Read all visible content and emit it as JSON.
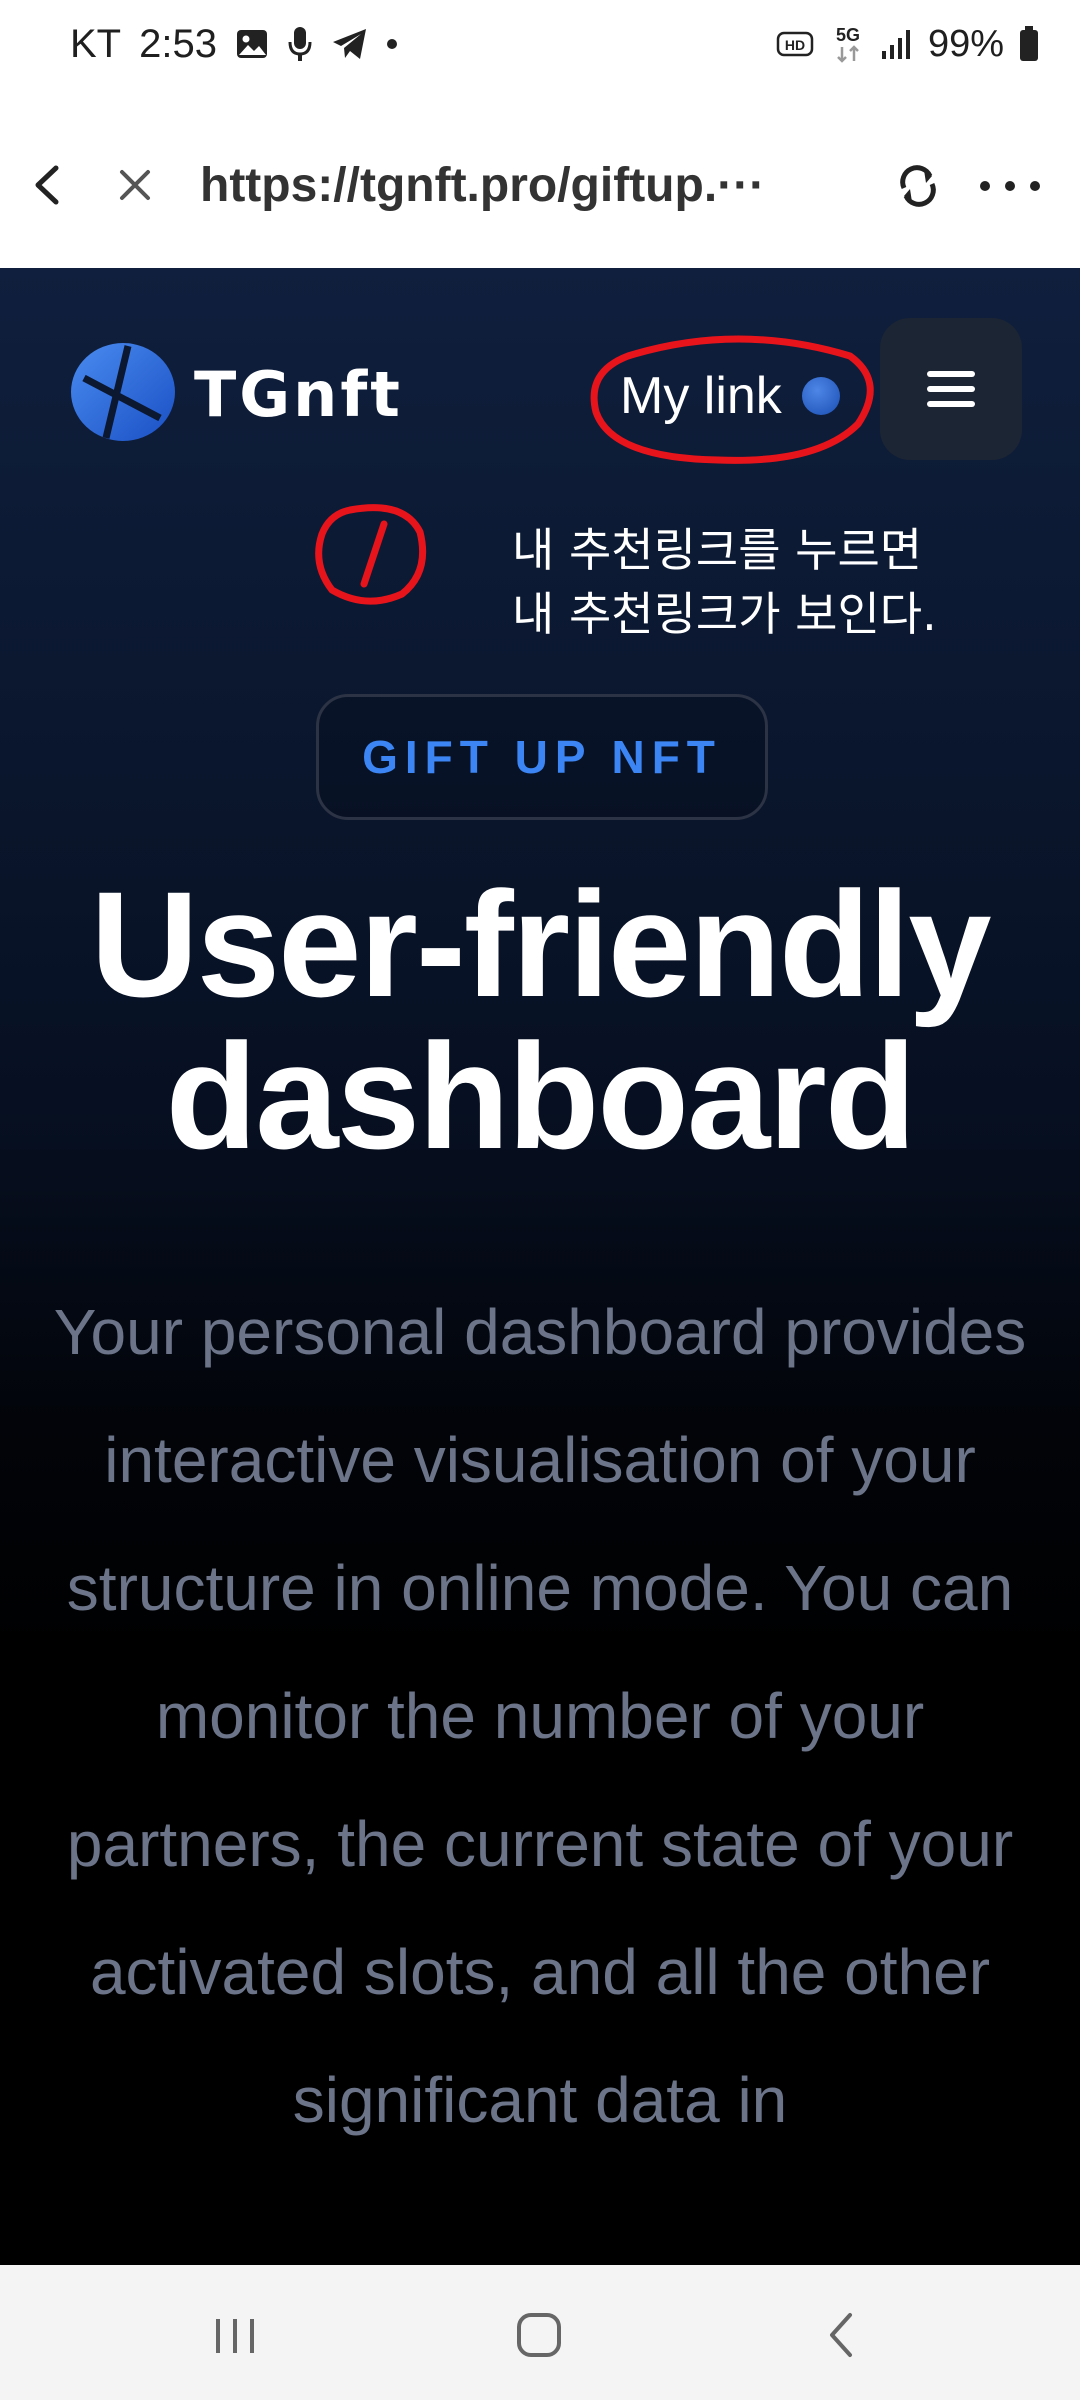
{
  "status_bar": {
    "carrier": "KT",
    "time": "2:53",
    "hd_label": "HD",
    "network_label": "5G",
    "battery": "99%"
  },
  "browser": {
    "url": "https://tgnft.pro/giftup.···"
  },
  "header": {
    "logo_text": "TGnft",
    "my_link_label": "My link"
  },
  "annotation": {
    "line1": "내 추천링크를 누르면",
    "line2": "내 추천링크가 보인다."
  },
  "hero": {
    "badge": "GIFT UP NFT",
    "title_line1": "User-friendly",
    "title_line2": "dashboard",
    "paragraph": "Your personal dashboard provides interactive visualisation of your structure in online mode. You can monitor the number of your partners, the current state of your activated slots, and all the other significant data in"
  },
  "colors": {
    "accent": "#3b86f4",
    "annotation_red": "#e8141b",
    "paragraph_text": "#6b7488",
    "page_bg_top": "#0f1f3d",
    "page_bg_bottom": "#000000"
  },
  "icons": {
    "status_left": [
      "image-icon",
      "microphone-icon",
      "telegram-icon",
      "dot-icon"
    ],
    "status_right": [
      "hd-icon",
      "5g-icon",
      "signal-icon",
      "battery-icon"
    ],
    "browser": [
      "back-icon",
      "close-icon",
      "sync-icon",
      "more-icon"
    ],
    "nav": [
      "recents-icon",
      "home-icon",
      "back-nav-icon"
    ]
  }
}
